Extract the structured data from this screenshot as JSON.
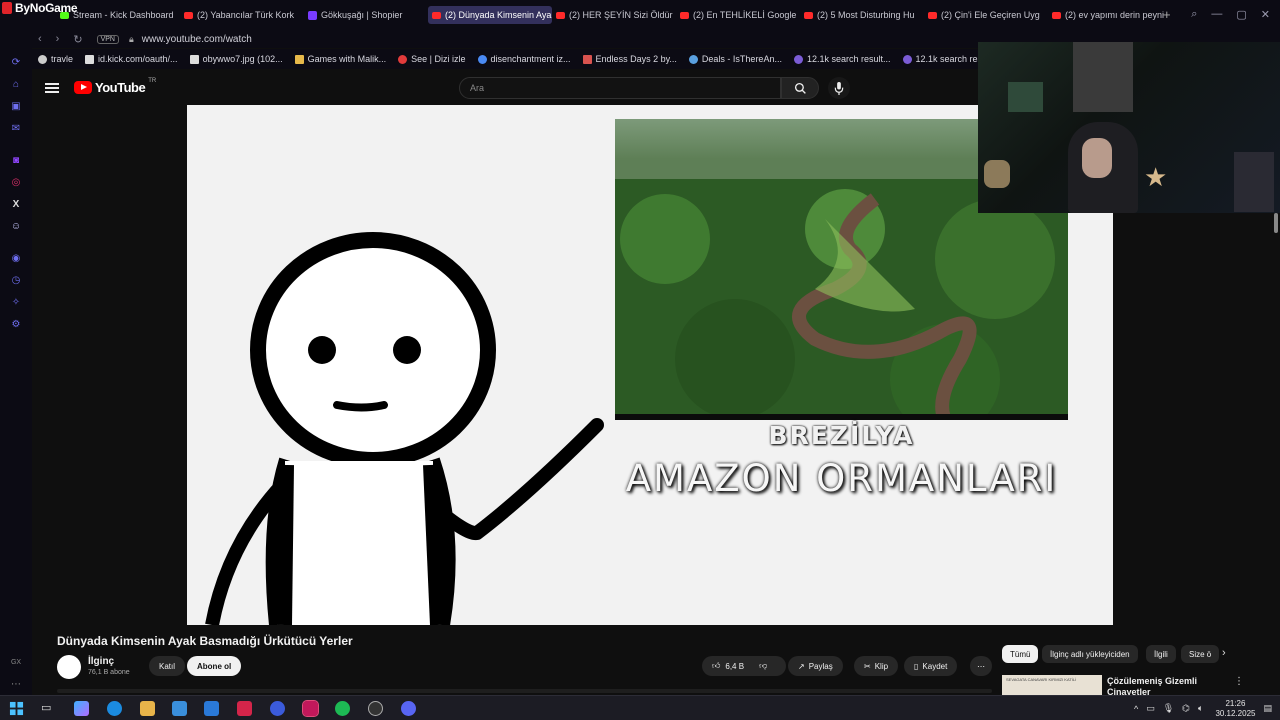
{
  "browser": {
    "brand": "ByNoGame",
    "tabs": [
      {
        "label": "Stream - Kick Dashboard",
        "icon": "kick-icon",
        "active": false
      },
      {
        "label": "(2) Yabancılar Türk Kork",
        "icon": "youtube-icon",
        "active": false
      },
      {
        "label": "Gökkuşağı | Shopier",
        "icon": "shopier-icon",
        "active": false
      },
      {
        "label": "(2) Dünyada Kimsenin Aya",
        "icon": "youtube-icon",
        "active": true
      },
      {
        "label": "(2) HER ŞEYİN Sizi Öldür",
        "icon": "youtube-icon",
        "active": false
      },
      {
        "label": "(2) En TEHLİKELİ Google",
        "icon": "youtube-icon",
        "active": false
      },
      {
        "label": "(2) 5 Most Disturbing Hu",
        "icon": "youtube-icon",
        "active": false
      },
      {
        "label": "(2) Çin'i Ele Geçiren Uyg",
        "icon": "youtube-icon",
        "active": false
      },
      {
        "label": "(2) ev yapımı derin peyni",
        "icon": "youtube-icon",
        "active": false
      }
    ],
    "vpn_label": "VPN",
    "url": "www.youtube.com/watch",
    "bookmarks": [
      {
        "label": "travle",
        "icon": "globe-icon"
      },
      {
        "label": "id.kick.com/oauth/...",
        "icon": "page-icon"
      },
      {
        "label": "obywwo7.jpg (102...",
        "icon": "page-icon"
      },
      {
        "label": "Games with Malik...",
        "icon": "folder-icon"
      },
      {
        "label": "See | Dizi izle",
        "icon": "play-icon"
      },
      {
        "label": "disenchantment iz...",
        "icon": "google-icon"
      },
      {
        "label": "Endless Days 2 by...",
        "icon": "image-icon"
      },
      {
        "label": "Deals - IsThereAn...",
        "icon": "tag-icon"
      },
      {
        "label": "12.1k search result...",
        "icon": "purple-icon"
      },
      {
        "label": "12.1k search result...",
        "icon": "purple-icon"
      }
    ]
  },
  "youtube": {
    "logo": "YouTube",
    "region": "TR",
    "search_placeholder": "Ara"
  },
  "video": {
    "caption_top": "BREZİLYA",
    "caption_main": "AMAZON ORMANLARI",
    "title": "Dünyada Kimsenin Ayak Basmadığı Ürkütücü Yerler",
    "channel": "İlginç",
    "subscribers": "76,1 B abone",
    "join_label": "Katıl",
    "subscribe_label": "Abone ol",
    "likes": "6,4 B",
    "share_label": "Paylaş",
    "clip_label": "Klip",
    "save_label": "Kaydet"
  },
  "chips": [
    "Tümü",
    "İlginç adlı yükleyiciden",
    "İlgili",
    "Size ö"
  ],
  "recommended": {
    "title": "Çözülemeniş Gizemli Cinayetler",
    "thumb_text": "SEVAGATA CANAVARI   KIRMIZI KATİLİ"
  },
  "taskbar": {
    "time": "21:26",
    "date": "30.12.2025"
  },
  "colors": {
    "accent_youtube": "#ff0000",
    "active_tab": "#33305c",
    "background": "#0f0f0f"
  }
}
